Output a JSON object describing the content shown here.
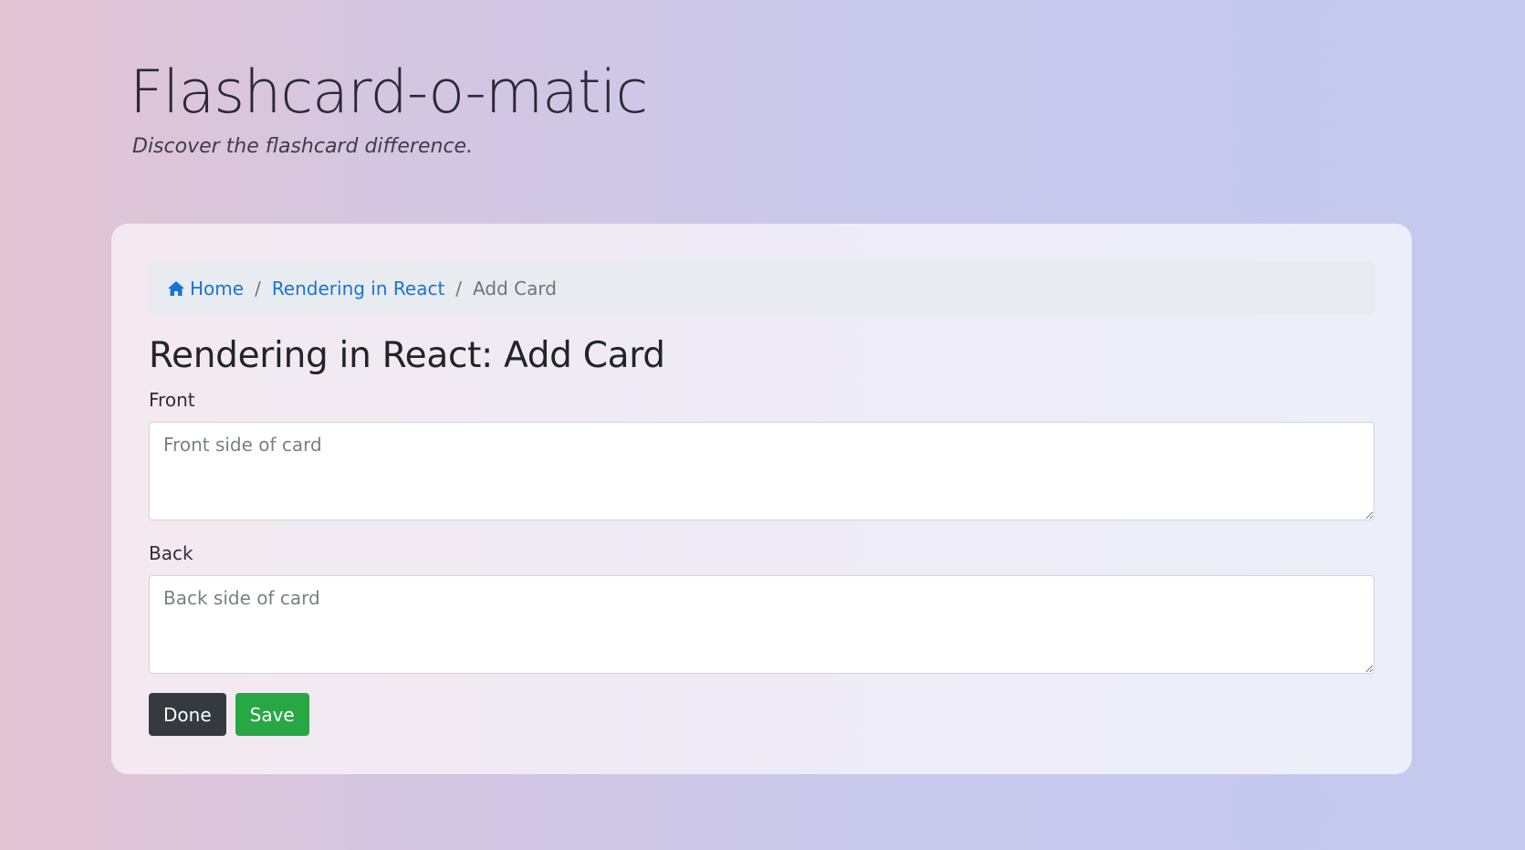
{
  "header": {
    "title": "Flashcard-o-matic",
    "tagline": "Discover the flashcard difference."
  },
  "breadcrumb": {
    "home_icon": "home-icon",
    "home_label": "Home",
    "deck_label": "Rendering in React",
    "current_label": "Add Card",
    "separator": "/"
  },
  "main": {
    "page_title": "Rendering in React: Add Card",
    "front": {
      "label": "Front",
      "placeholder": "Front side of card",
      "value": ""
    },
    "back": {
      "label": "Back",
      "placeholder": "Back side of card",
      "value": ""
    },
    "buttons": {
      "done_label": "Done",
      "save_label": "Save"
    }
  },
  "colors": {
    "link": "#1a73d8",
    "done_button": "#343a40",
    "save_button": "#28a745",
    "breadcrumb_bg": "#e8ebef"
  }
}
